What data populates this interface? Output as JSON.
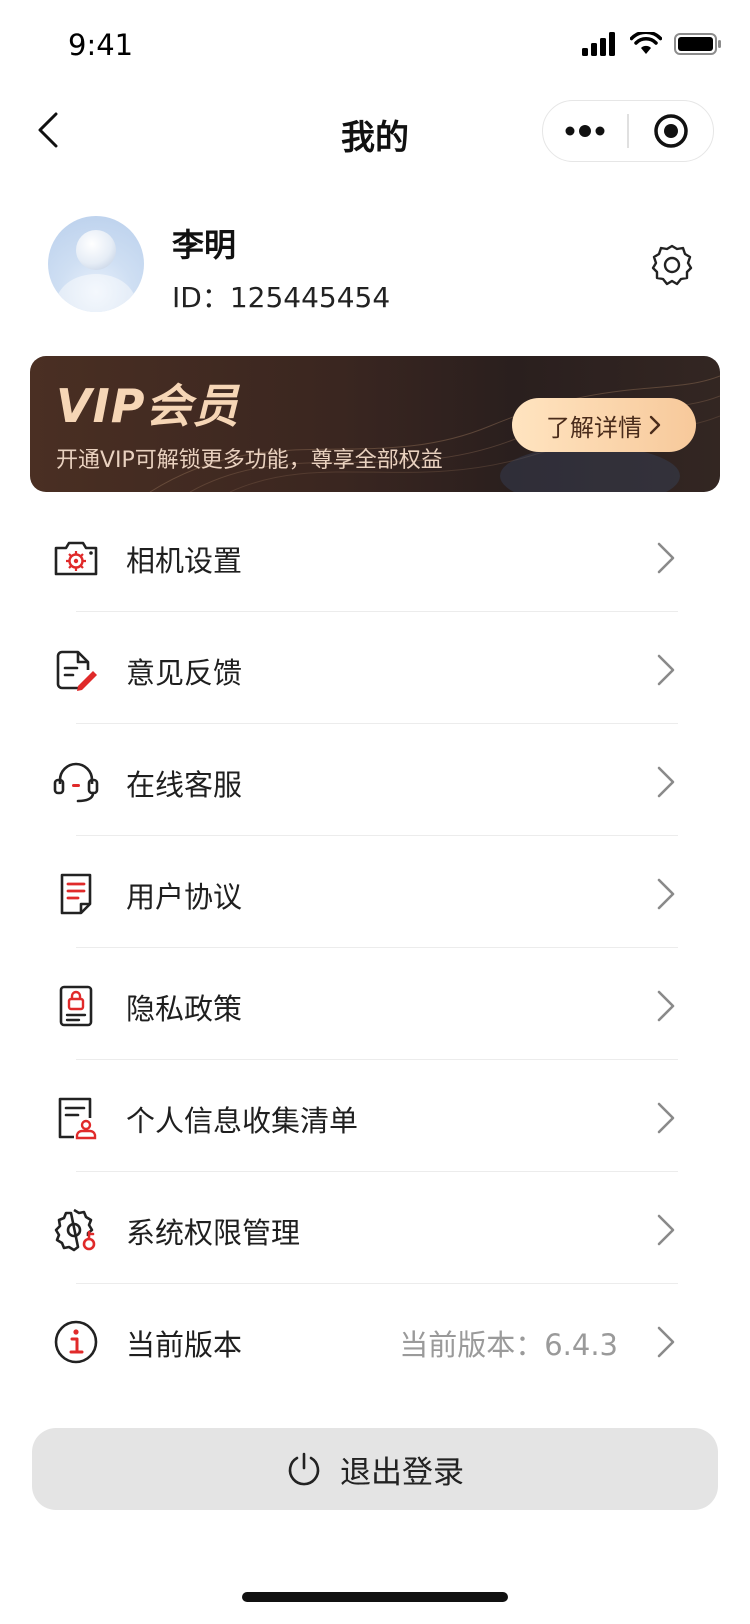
{
  "status_bar": {
    "time": "9:41"
  },
  "nav": {
    "title": "我的"
  },
  "profile": {
    "name": "李明",
    "id_text": "ID：125445454"
  },
  "vip": {
    "title": "VIP会员",
    "subtitle": "开通VIP可解锁更多功能，尊享全部权益",
    "button_label": "了解详情"
  },
  "menu": {
    "items": [
      {
        "label": "相机设置",
        "icon": "camera-settings-icon"
      },
      {
        "label": "意见反馈",
        "icon": "feedback-icon"
      },
      {
        "label": "在线客服",
        "icon": "headset-icon"
      },
      {
        "label": "用户协议",
        "icon": "document-icon"
      },
      {
        "label": "隐私政策",
        "icon": "privacy-lock-icon"
      },
      {
        "label": "个人信息收集清单",
        "icon": "personal-info-icon"
      },
      {
        "label": "系统权限管理",
        "icon": "permission-gear-icon"
      },
      {
        "label": "当前版本",
        "icon": "info-icon",
        "value": "当前版本：6.4.3"
      }
    ]
  },
  "logout": {
    "label": "退出登录"
  },
  "colors": {
    "accent_red": "#e02a2a",
    "vip_gold": "#f6d6b6",
    "logout_bg": "#e4e4e4"
  }
}
